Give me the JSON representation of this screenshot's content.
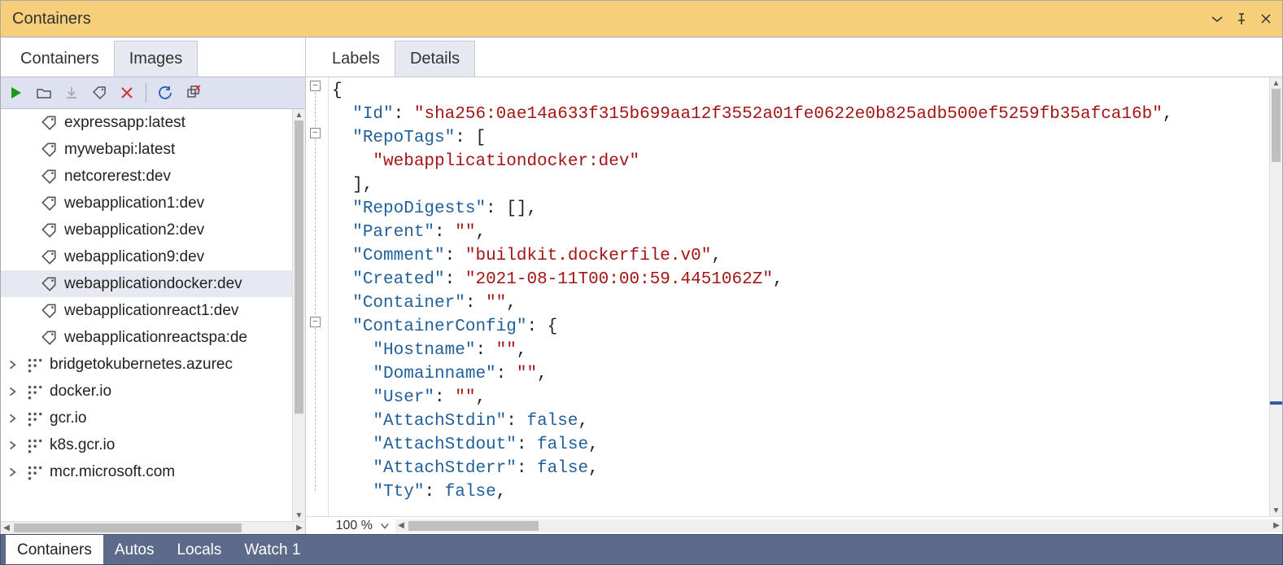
{
  "window": {
    "title": "Containers"
  },
  "left_tabs": [
    "Containers",
    "Images"
  ],
  "right_tabs": [
    "Labels",
    "Details"
  ],
  "zoom": "100 %",
  "bottom_tabs": [
    "Containers",
    "Autos",
    "Locals",
    "Watch 1"
  ],
  "tree": {
    "images": [
      "expressapp:latest",
      "mywebapi:latest",
      "netcorerest:dev",
      "webapplication1:dev",
      "webapplication2:dev",
      "webapplication9:dev",
      "webapplicationdocker:dev",
      "webapplicationreact1:dev",
      "webapplicationreactspa:de"
    ],
    "registries": [
      "bridgetokubernetes.azurec",
      "docker.io",
      "gcr.io",
      "k8s.gcr.io",
      "mcr.microsoft.com"
    ]
  },
  "details_json": {
    "Id": "sha256:0ae14a633f315b699aa12f3552a01fe0622e0b825adb500ef5259fb35afca16b",
    "RepoTags": [
      "webapplicationdocker:dev"
    ],
    "RepoDigests": [],
    "Parent": "",
    "Comment": "buildkit.dockerfile.v0",
    "Created": "2021-08-11T00:00:59.4451062Z",
    "Container": "",
    "ContainerConfig": {
      "Hostname": "",
      "Domainname": "",
      "User": "",
      "AttachStdin": false,
      "AttachStdout": false,
      "AttachStderr": false,
      "Tty": false
    }
  }
}
